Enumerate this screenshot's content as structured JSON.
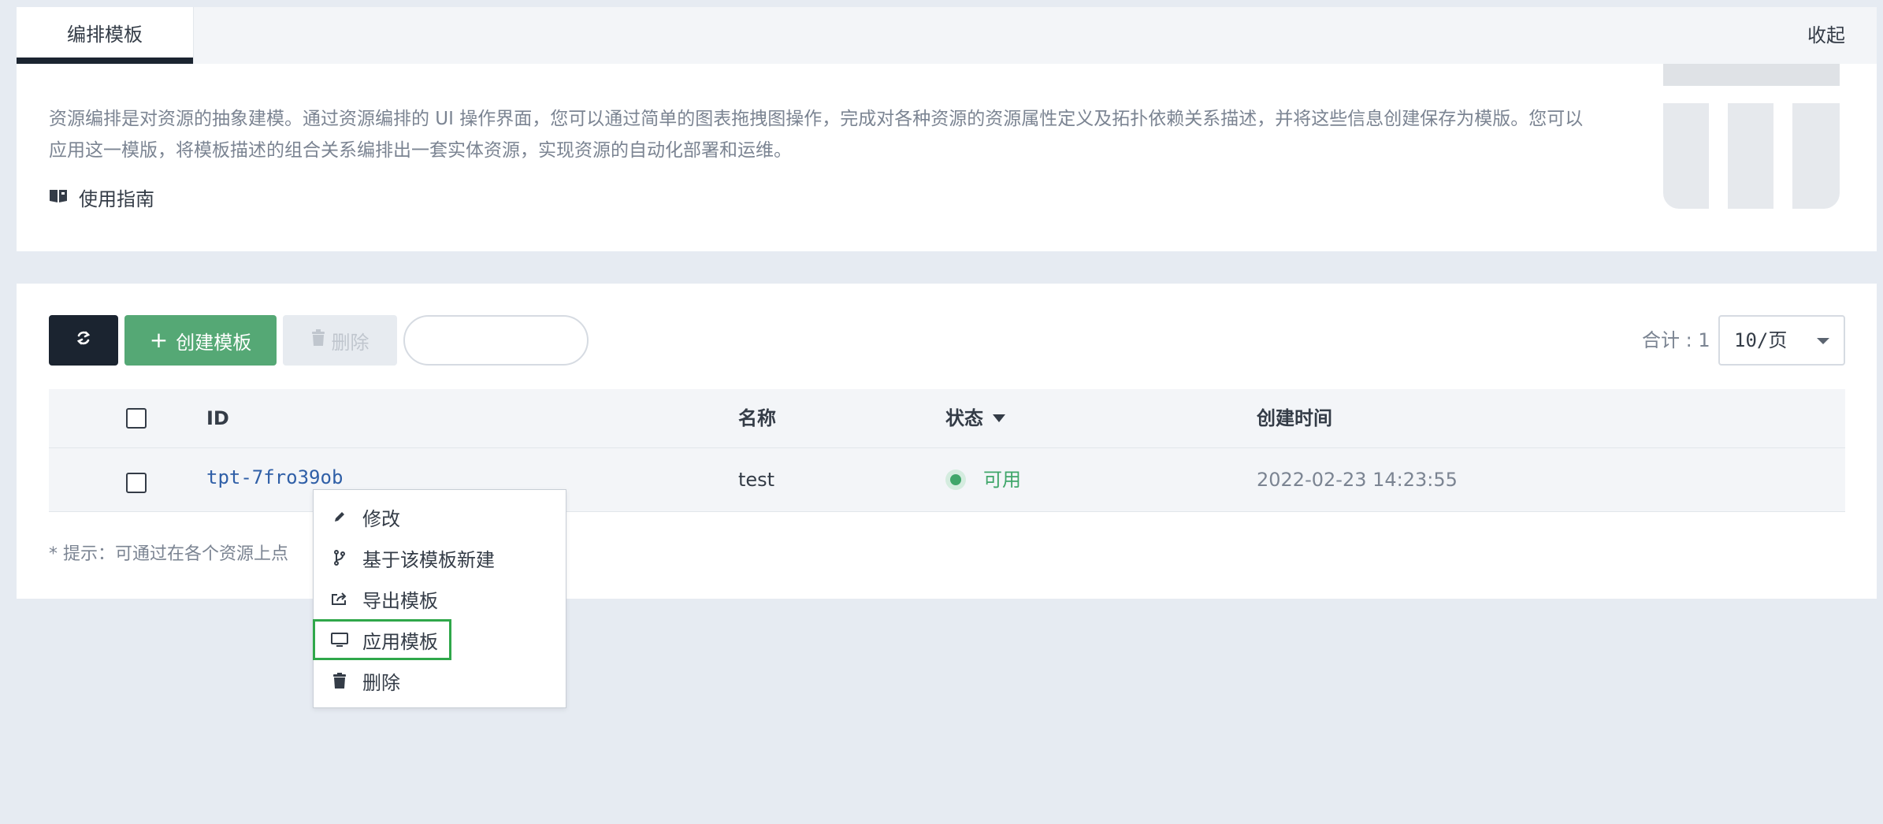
{
  "tabs": {
    "active_label": "编排模板",
    "collapse_label": "收起"
  },
  "intro": {
    "description": "资源编排是对资源的抽象建模。通过资源编排的 UI 操作界面，您可以通过简单的图表拖拽图操作，完成对各种资源的资源属性定义及拓扑依赖关系描述，并将这些信息创建保存为模版。您可以应用这一模版，将模板描述的组合关系编排出一套实体资源，实现资源的自动化部署和运维。",
    "guide_label": "使用指南"
  },
  "toolbar": {
    "create_label": "创建模板",
    "delete_label": "删除",
    "search_placeholder": "",
    "total_label": "合计 : 1",
    "page_size": "10/页"
  },
  "table": {
    "headers": {
      "id": "ID",
      "name": "名称",
      "status": "状态",
      "created": "创建时间"
    },
    "rows": [
      {
        "id": "tpt-7fro39ob",
        "name": "test",
        "status": "可用",
        "created": "2022-02-23 14:23:55"
      }
    ]
  },
  "hint": "* 提示：可通过在各个资源上点",
  "context_menu": {
    "items": [
      {
        "label": "修改",
        "icon": "pencil-icon"
      },
      {
        "label": "基于该模板新建",
        "icon": "branch-icon"
      },
      {
        "label": "导出模板",
        "icon": "export-icon"
      },
      {
        "label": "应用模板",
        "icon": "monitor-icon"
      },
      {
        "label": "删除",
        "icon": "trash-icon"
      }
    ]
  },
  "colors": {
    "primary": "#55a875",
    "dark": "#1b2430",
    "link": "#2f5fa7",
    "status_ok": "#3fa66a",
    "highlight": "#2fa74a"
  }
}
